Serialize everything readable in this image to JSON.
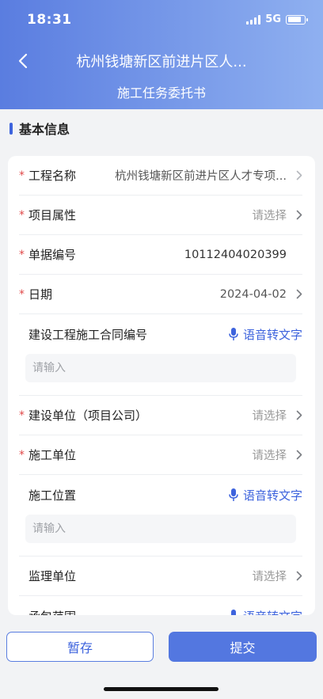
{
  "status_bar": {
    "time": "18:31",
    "network": "5G",
    "battery_percent": 80
  },
  "header": {
    "title": "杭州钱塘新区前进片区人...",
    "subtitle": "施工任务委托书"
  },
  "section": {
    "title": "基本信息"
  },
  "form": {
    "project_name": {
      "label": "工程名称",
      "value": "杭州钱塘新区前进片区人才专项...",
      "required": true
    },
    "project_attr": {
      "label": "项目属性",
      "placeholder": "请选择",
      "required": true
    },
    "doc_no": {
      "label": "单据编号",
      "value": "10112404020399",
      "required": true
    },
    "date": {
      "label": "日期",
      "value": "2024-04-02",
      "required": true
    },
    "contract_no": {
      "label": "建设工程施工合同编号",
      "voice_label": "语音转文字",
      "input_placeholder": "请输入"
    },
    "build_unit": {
      "label": "建设单位（项目公司）",
      "placeholder": "请选择",
      "required": true
    },
    "construct_unit": {
      "label": "施工单位",
      "placeholder": "请选择",
      "required": true
    },
    "construct_location": {
      "label": "施工位置",
      "voice_label": "语音转文字",
      "input_placeholder": "请输入"
    },
    "supervise_unit": {
      "label": "监理单位",
      "placeholder": "请选择"
    },
    "contract_scope": {
      "label": "承包范围",
      "voice_label": "语音转文字"
    }
  },
  "required_mark": "*",
  "footer": {
    "save_label": "暂存",
    "submit_label": "提交"
  },
  "colors": {
    "accent": "#3d63dd",
    "header_start": "#5a7de0",
    "header_end": "#8fb0f0",
    "required": "#e04848"
  }
}
